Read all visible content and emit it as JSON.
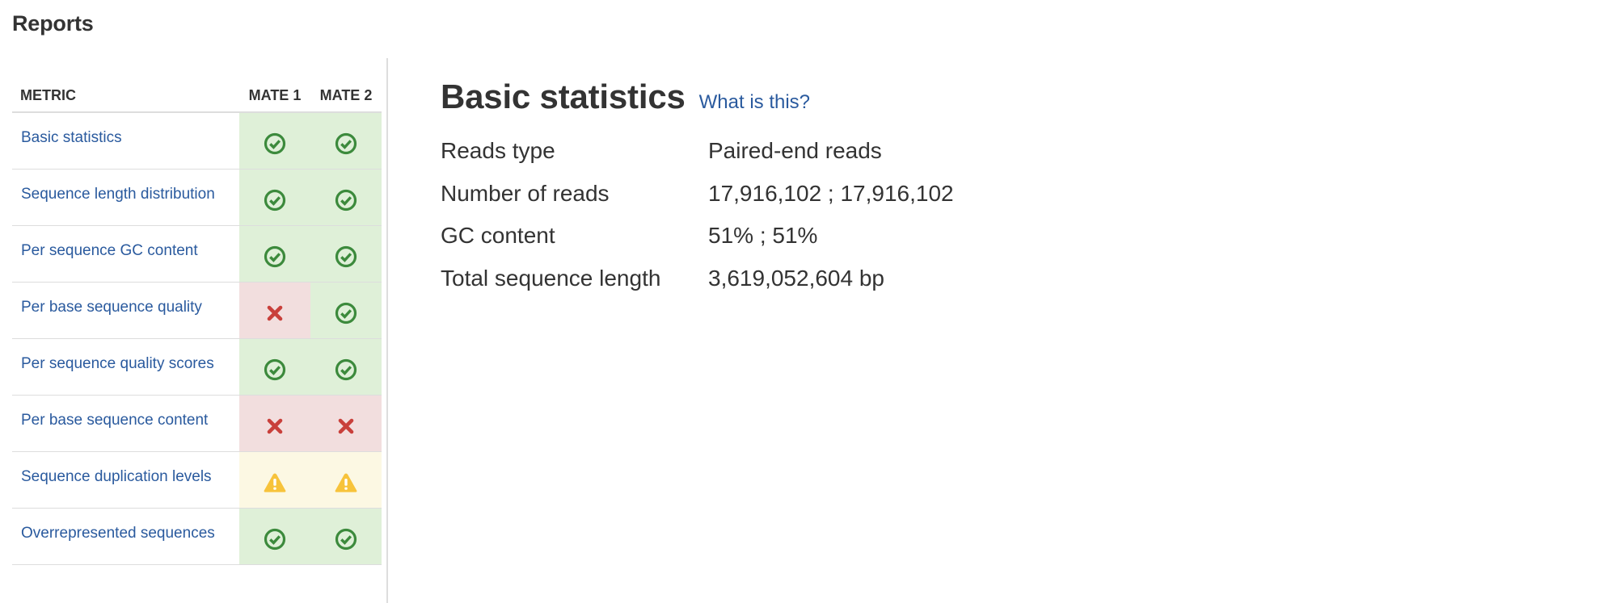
{
  "page": {
    "heading": "Reports"
  },
  "metrics_table": {
    "headers": {
      "metric": "METRIC",
      "mate1": "MATE 1",
      "mate2": "MATE 2"
    },
    "rows": [
      {
        "label": "Basic statistics",
        "mate1": "pass",
        "mate2": "pass"
      },
      {
        "label": "Sequence length distribution",
        "mate1": "pass",
        "mate2": "pass"
      },
      {
        "label": "Per sequence GC content",
        "mate1": "pass",
        "mate2": "pass"
      },
      {
        "label": "Per base sequence quality",
        "mate1": "fail",
        "mate2": "pass"
      },
      {
        "label": "Per sequence quality scores",
        "mate1": "pass",
        "mate2": "pass"
      },
      {
        "label": "Per base sequence content",
        "mate1": "fail",
        "mate2": "fail"
      },
      {
        "label": "Sequence duplication levels",
        "mate1": "warn",
        "mate2": "warn"
      },
      {
        "label": "Overrepresented sequences",
        "mate1": "pass",
        "mate2": "pass"
      }
    ]
  },
  "status_icons": {
    "pass": "check-circle-icon",
    "fail": "x-mark-icon",
    "warn": "warning-triangle-icon"
  },
  "colors": {
    "pass_bg": "#dff0d8",
    "fail_bg": "#f2dede",
    "warn_bg": "#fcf8e3",
    "pass_icon": "#3c8a3c",
    "fail_icon": "#c9403b",
    "warn_icon": "#f7c33b",
    "link": "#2a5a9e"
  },
  "details": {
    "title": "Basic statistics",
    "help_link": "What is this?",
    "stats": [
      {
        "label": "Reads type",
        "value": "Paired-end reads"
      },
      {
        "label": "Number of reads",
        "value": "17,916,102 ; 17,916,102"
      },
      {
        "label": "GC content",
        "value": "51% ; 51%"
      },
      {
        "label": "Total sequence length",
        "value": "3,619,052,604 bp"
      }
    ]
  }
}
